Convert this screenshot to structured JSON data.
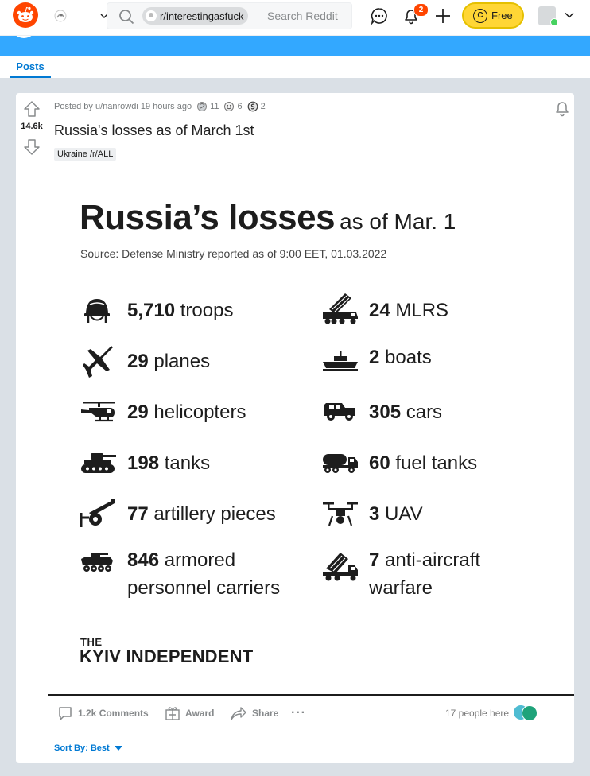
{
  "header": {
    "search_chip": "r/interestingasfuck",
    "search_placeholder": "Search Reddit",
    "notification_count": "2",
    "premium_label": "Free",
    "premium_coin_glyph": "C",
    "icons": [
      "reddit-logo-icon",
      "community-icon",
      "chevron-down-icon",
      "search-icon",
      "chat-icon",
      "bell-icon",
      "plus-icon",
      "avatar-icon"
    ]
  },
  "tabs": {
    "posts": "Posts"
  },
  "post": {
    "posted_by": "Posted by u/nanrowdi 19 hours ago",
    "awards": [
      {
        "icon": "silver-award-icon",
        "count": "11"
      },
      {
        "icon": "helpful-award-icon",
        "count": "6"
      },
      {
        "icon": "wholesome-award-icon",
        "count": "2"
      }
    ],
    "score": "14.6k",
    "title": "Russia's losses as of March 1st",
    "flair": "Ukraine /r/ALL",
    "comments_label": "1.2k Comments",
    "award_label": "Award",
    "share_label": "Share",
    "more_label": "···",
    "people_here": "17 people here",
    "sort_label": "Sort By: Best"
  },
  "infographic": {
    "title_main": "Russia’s losses",
    "title_suffix": "as of Mar. 1",
    "source": "Source: Defense Ministry reported as of 9:00 EET, 01.03.2022",
    "items": [
      {
        "number": "5,710",
        "label": "troops",
        "icon": "helmet-icon"
      },
      {
        "number": "24",
        "label": "MLRS",
        "icon": "rocket-launcher-icon"
      },
      {
        "number": "29",
        "label": "planes",
        "icon": "jet-icon"
      },
      {
        "number": "2",
        "label": "boats",
        "icon": "boat-icon"
      },
      {
        "number": "29",
        "label": "helicopters",
        "icon": "helicopter-icon"
      },
      {
        "number": "305",
        "label": "cars",
        "icon": "jeep-icon"
      },
      {
        "number": "198",
        "label": "tanks",
        "icon": "tank-icon"
      },
      {
        "number": "60",
        "label": "fuel tanks",
        "icon": "fuel-truck-icon"
      },
      {
        "number": "77",
        "label": "artillery pieces",
        "icon": "cannon-icon"
      },
      {
        "number": "3",
        "label": "UAV",
        "icon": "drone-icon"
      },
      {
        "number": "846",
        "label": "armored",
        "label2": "personnel carriers",
        "icon": "apc-icon"
      },
      {
        "number": "7",
        "label": "anti-aircraft",
        "label2": "warfare",
        "icon": "anti-aircraft-icon"
      }
    ],
    "publisher_small": "THE",
    "publisher_name": "KYIV INDEPENDENT"
  },
  "colors": {
    "reddit_orange": "#ff4500",
    "banner_blue": "#33a8ff",
    "link_blue": "#0079d3",
    "premium_yellow": "#ffd635",
    "page_bg": "#dae0e6"
  }
}
